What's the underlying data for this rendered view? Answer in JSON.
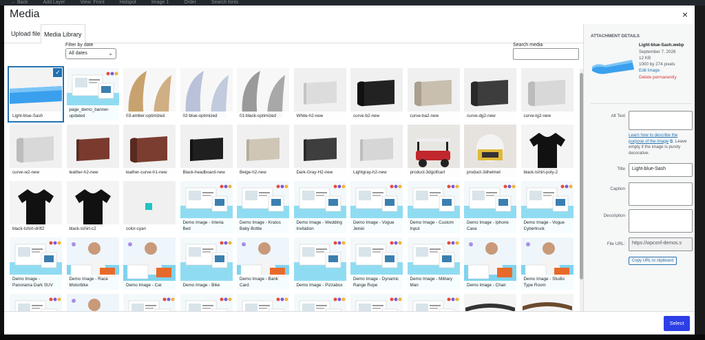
{
  "background_bar": {
    "items": [
      "← Back",
      "Add Layer",
      "View: Front",
      "Hotspot",
      "Image 1",
      "Order",
      "Search fonts"
    ]
  },
  "modal": {
    "title": "Media",
    "close_symbol": "×",
    "tabs": [
      {
        "label": "Upload files",
        "active": false
      },
      {
        "label": "Media Library",
        "active": true
      }
    ]
  },
  "toolbar": {
    "filter_label": "Filter by date",
    "filter_value": "All dates",
    "search_label": "Search media",
    "search_value": ""
  },
  "grid": {
    "items": [
      {
        "caption": "Light-blue-Sash",
        "thumb": "sash-blue",
        "selected": true
      },
      {
        "caption": "page_demo_banner-updated",
        "thumb": "demo",
        "selected": false
      },
      {
        "caption": "03-amber-optimized",
        "thumb": "leaf-amber",
        "selected": false
      },
      {
        "caption": "02-blue-optimized",
        "thumb": "leaf-blue",
        "selected": false
      },
      {
        "caption": "01-black-optimized",
        "thumb": "leaf-black",
        "selected": false
      },
      {
        "caption": "White-h2-new",
        "thumb": "panel-white",
        "selected": false
      },
      {
        "caption": "curve-b2-new",
        "thumb": "curve-black",
        "selected": false
      },
      {
        "caption": "curve-ba2-new",
        "thumb": "curve-beige",
        "selected": false
      },
      {
        "caption": "curve-dg2-new",
        "thumb": "curve-dark",
        "selected": false
      },
      {
        "caption": "curve-lg2-new",
        "thumb": "curve-light",
        "selected": false
      },
      {
        "caption": "curve-w2-new",
        "thumb": "curve-light",
        "selected": false
      },
      {
        "caption": "leather-h2-new",
        "thumb": "panel-leather",
        "selected": false
      },
      {
        "caption": "leather-curve-h1-new",
        "thumb": "curve-leather",
        "selected": false
      },
      {
        "caption": "Black-headboard-new",
        "thumb": "panel-black",
        "selected": false
      },
      {
        "caption": "Beige-h2-new",
        "thumb": "panel-beige",
        "selected": false
      },
      {
        "caption": "Dark-Gray-H2-new",
        "thumb": "panel-dark",
        "selected": false
      },
      {
        "caption": "Lightgray-h2-new",
        "thumb": "panel-lightgray",
        "selected": false
      },
      {
        "caption": "product-3dgolfcart",
        "thumb": "golfcart",
        "selected": false
      },
      {
        "caption": "product-3dhelmet",
        "thumb": "helmet",
        "selected": false
      },
      {
        "caption": "black-tshirt-poly-2",
        "thumb": "tshirt",
        "selected": false
      },
      {
        "caption": "black-tshirt-drift2",
        "thumb": "tshirt",
        "selected": false
      },
      {
        "caption": "black-tshirt-c2",
        "thumb": "tshirt",
        "selected": false
      },
      {
        "caption": "color-cyan",
        "thumb": "cyan",
        "selected": false
      },
      {
        "caption": "Demo Image - Interia Bed",
        "thumb": "demo",
        "selected": false
      },
      {
        "caption": "Demo Image - Kratos Baby Bottle",
        "thumb": "demo",
        "selected": false
      },
      {
        "caption": "Demo Image - Wedding Invitation",
        "thumb": "demo",
        "selected": false
      },
      {
        "caption": "Demo Image - Vogue Jetski",
        "thumb": "demo",
        "selected": false
      },
      {
        "caption": "Demo Image - Custom Input",
        "thumb": "demo",
        "selected": false
      },
      {
        "caption": "Demo Image - Iphone Case",
        "thumb": "demo",
        "selected": false
      },
      {
        "caption": "Demo Image - Vogue Cybertruck",
        "thumb": "demo",
        "selected": false
      },
      {
        "caption": "Demo Image - Panorama Dark SUV",
        "thumb": "demo",
        "selected": false
      },
      {
        "caption": "Demo Image - Race Motorbike",
        "thumb": "demo-person",
        "selected": false
      },
      {
        "caption": "Demo Image - Car",
        "thumb": "demo-person",
        "selected": false
      },
      {
        "caption": "Demo Image - Bike",
        "thumb": "demo",
        "selected": false
      },
      {
        "caption": "Demo Image - Bank Card",
        "thumb": "demo-person",
        "selected": false
      },
      {
        "caption": "Demo Image - Pizzabox",
        "thumb": "demo",
        "selected": false
      },
      {
        "caption": "Demo Image - Dynamic Range Rope",
        "thumb": "demo",
        "selected": false
      },
      {
        "caption": "Demo Image - Military Man",
        "thumb": "demo",
        "selected": false
      },
      {
        "caption": "Demo Image - Chair",
        "thumb": "demo-person",
        "selected": false
      },
      {
        "caption": "Demo Image - Studio Type Room",
        "thumb": "demo-person",
        "selected": false
      },
      {
        "caption": "",
        "thumb": "demo",
        "selected": false
      },
      {
        "caption": "",
        "thumb": "demo-person",
        "selected": false
      },
      {
        "caption": "",
        "thumb": "demo",
        "selected": false
      },
      {
        "caption": "",
        "thumb": "demo",
        "selected": false
      },
      {
        "caption": "",
        "thumb": "demo",
        "selected": false
      },
      {
        "caption": "",
        "thumb": "demo",
        "selected": false
      },
      {
        "caption": "",
        "thumb": "demo",
        "selected": false
      },
      {
        "caption": "",
        "thumb": "demo",
        "selected": false
      },
      {
        "caption": "",
        "thumb": "frame-dark",
        "selected": false
      },
      {
        "caption": "",
        "thumb": "frame-brown",
        "selected": false
      }
    ]
  },
  "sidebar": {
    "heading": "ATTACHMENT DETAILS",
    "filename": "Light-blue-Sash.webp",
    "date": "September 7, 2026",
    "filesize": "12 KB",
    "dimensions": "1000 by 274 pixels",
    "edit_link": "Edit Image",
    "delete_link": "Delete permanently",
    "alt_text_label": "Alt Text",
    "alt_text_value": "",
    "alt_help_link": "Learn how to describe the purpose of the image",
    "alt_help_rest": "Leave empty if the image is purely decorative.",
    "external_icon": "external-link-icon",
    "title_label": "Title",
    "title_value": "Light-blue-Sash",
    "caption_label": "Caption",
    "caption_value": "",
    "description_label": "Description",
    "description_value": "",
    "file_url_label": "File URL:",
    "file_url_value": "https://wpconf-demos.s",
    "copy_button": "Copy URL to clipboard"
  },
  "footer": {
    "select_button": "Select"
  },
  "colors": {
    "accent": "#2271b1",
    "primary_button": "#2c3fe6",
    "danger": "#d63638",
    "sash_blue": "#3aa0ee"
  }
}
